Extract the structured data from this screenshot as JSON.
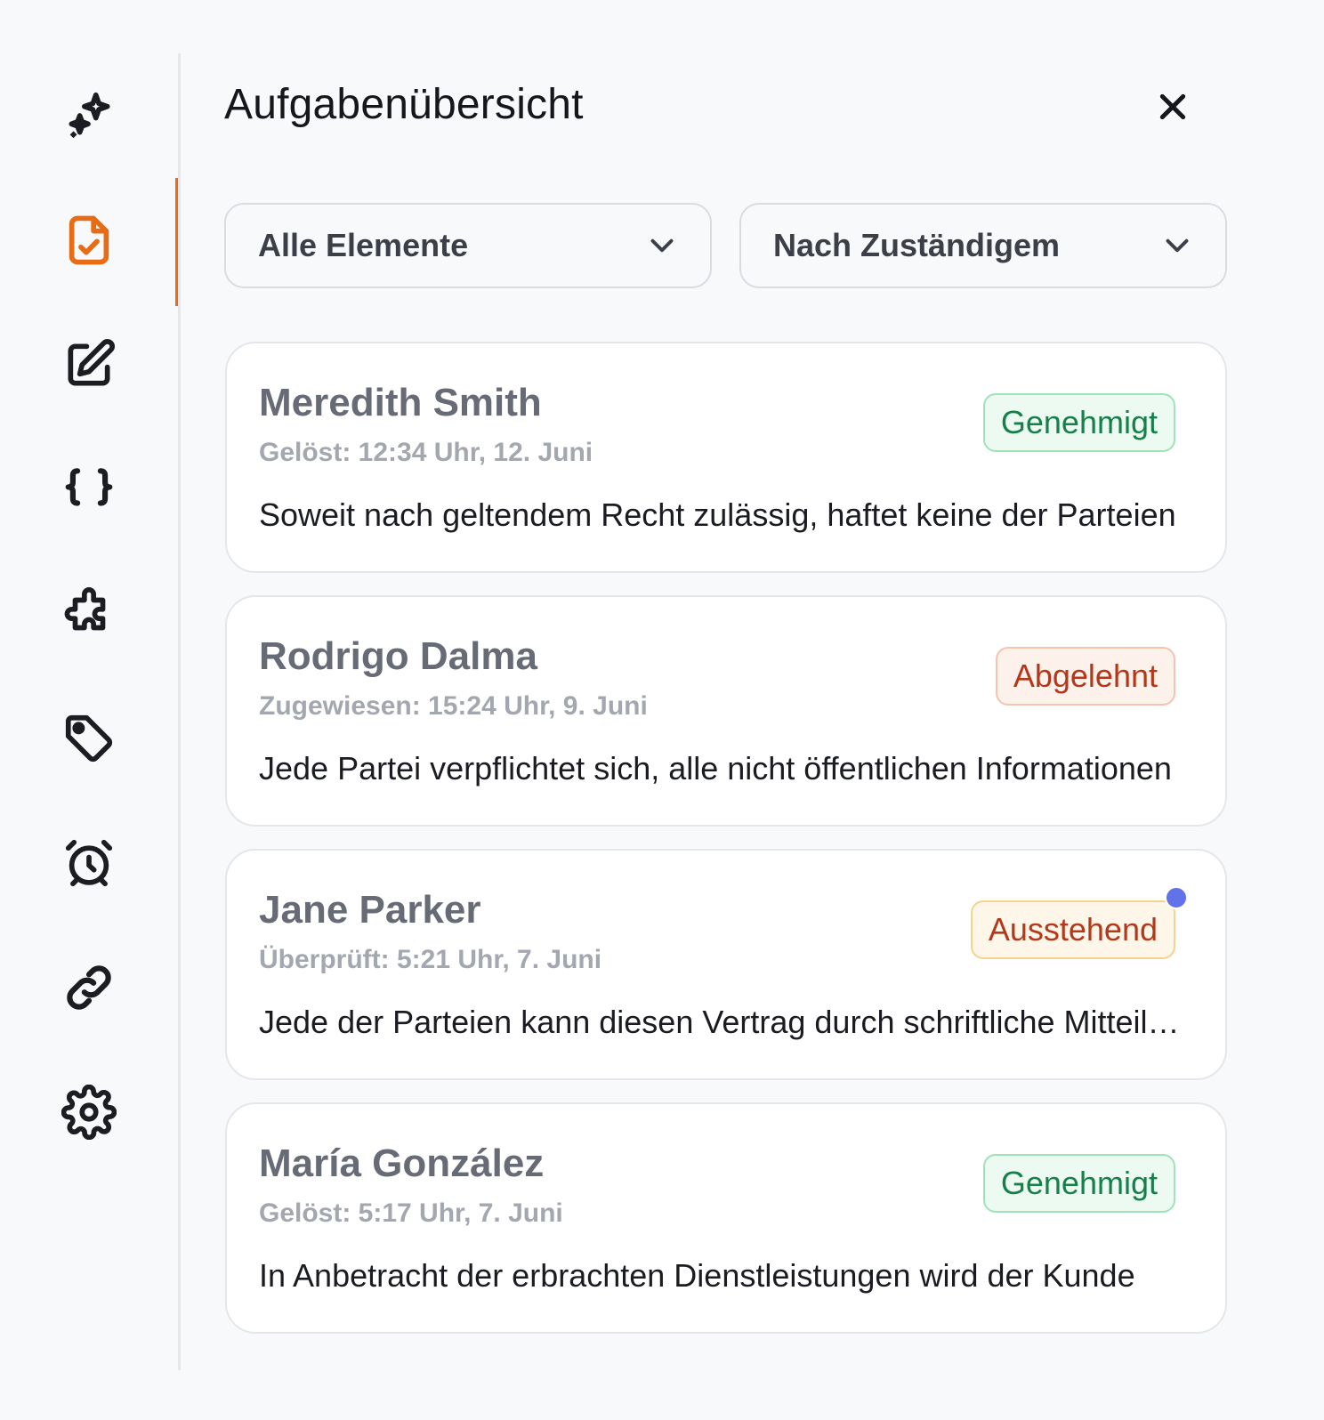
{
  "header": {
    "title": "Aufgabenübersicht",
    "close_icon": "close-icon"
  },
  "filters": {
    "scope": {
      "selected": "Alle Elemente"
    },
    "grouping": {
      "selected": "Nach Zuständigem"
    }
  },
  "sidebar": {
    "active_color": "#e76c15",
    "items": [
      {
        "icon": "sparkles-icon",
        "active": false
      },
      {
        "icon": "file-check-icon",
        "active": true
      },
      {
        "icon": "edit-icon",
        "active": false
      },
      {
        "icon": "braces-icon",
        "active": false
      },
      {
        "icon": "puzzle-icon",
        "active": false
      },
      {
        "icon": "tag-icon",
        "active": false
      },
      {
        "icon": "alarm-clock-icon",
        "active": false
      },
      {
        "icon": "link-icon",
        "active": false
      },
      {
        "icon": "settings-icon",
        "active": false
      }
    ]
  },
  "tasks": [
    {
      "name": "Meredith Smith",
      "meta": "Gelöst: 12:34 Uhr, 12. Juni",
      "status": "Genehmigt",
      "excerpt": "Soweit nach geltendem Recht zulässig, haftet keine der Parteien",
      "unread": false
    },
    {
      "name": "Rodrigo Dalma",
      "meta": "Zugewiesen: 15:24 Uhr, 9. Juni",
      "status": "Abgelehnt",
      "excerpt": "Jede Partei verpflichtet sich, alle nicht öffentlichen Informationen",
      "unread": false
    },
    {
      "name": "Jane Parker",
      "meta": "Überprüft: 5:21 Uhr, 7. Juni",
      "status": "Ausstehend",
      "excerpt": "Jede der Parteien kann diesen Vertrag durch schriftliche Mitteilung",
      "unread": true
    },
    {
      "name": "María González",
      "meta": "Gelöst: 5:17 Uhr, 7. Juni",
      "status": "Genehmigt",
      "excerpt": "In Anbetracht der erbrachten Dienstleistungen wird der Kunde",
      "unread": false
    }
  ],
  "status_colors": {
    "approved": "#16804b",
    "rejected": "#b5371a",
    "pending": "#b4381a",
    "unread_dot": "#6272e8"
  }
}
